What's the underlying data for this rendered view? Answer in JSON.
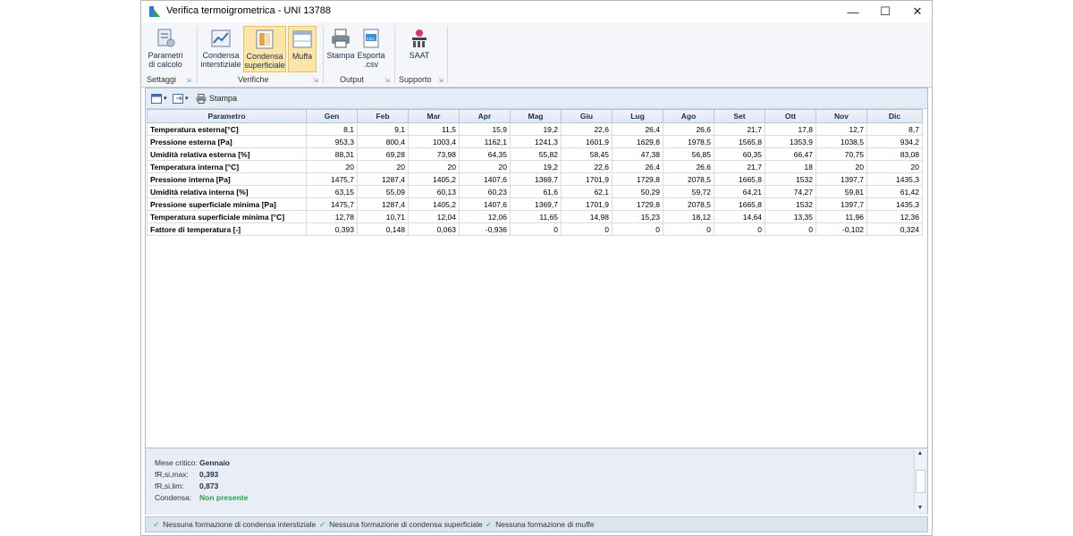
{
  "window": {
    "title": "Verifica termoigrometrica - UNI 13788",
    "controls": {
      "minimize": "—",
      "maximize": "☐",
      "close": "✕"
    }
  },
  "ribbon": {
    "groups": [
      {
        "label": "Settaggi",
        "buttons": [
          {
            "label_line1": "Parametri",
            "label_line2": "di calcolo",
            "icon": "sliders-icon"
          }
        ]
      },
      {
        "label": "Verifiche",
        "buttons": [
          {
            "label_line1": "Condensa",
            "label_line2": "interstiziale",
            "icon": "chart-icon"
          },
          {
            "label_line1": "Condensa",
            "label_line2": "superficiale",
            "icon": "panel-icon",
            "selected": true
          },
          {
            "label_line1": "Muffa",
            "label_line2": "",
            "icon": "window-icon",
            "selected": true
          }
        ]
      },
      {
        "label": "Output",
        "buttons": [
          {
            "label_line1": "Stampa",
            "label_line2": "",
            "icon": "printer-icon"
          },
          {
            "label_line1": "Esporta",
            "label_line2": ".csv",
            "icon": "export-icon"
          }
        ]
      },
      {
        "label": "Supporto",
        "buttons": [
          {
            "label_line1": "SAAT",
            "label_line2": "",
            "icon": "saat-icon"
          }
        ]
      }
    ]
  },
  "toolbar": {
    "print_label": "Stampa"
  },
  "table": {
    "columns": [
      "Parametro",
      "Gen",
      "Feb",
      "Mar",
      "Apr",
      "Mag",
      "Giu",
      "Lug",
      "Ago",
      "Set",
      "Ott",
      "Nov",
      "Dic"
    ],
    "rows": [
      [
        "Temperatura esterna[°C]",
        "8,1",
        "9,1",
        "11,5",
        "15,9",
        "19,2",
        "22,6",
        "26,4",
        "26,6",
        "21,7",
        "17,8",
        "12,7",
        "8,7"
      ],
      [
        "Pressione esterna [Pa]",
        "953,3",
        "800,4",
        "1003,4",
        "1162,1",
        "1241,3",
        "1601,9",
        "1629,8",
        "1978,5",
        "1565,8",
        "1353,9",
        "1038,5",
        "934,2"
      ],
      [
        "Umidità relativa esterna [%]",
        "88,31",
        "69,28",
        "73,98",
        "64,35",
        "55,82",
        "58,45",
        "47,38",
        "56,85",
        "60,35",
        "66,47",
        "70,75",
        "83,08"
      ],
      [
        "Temperatura interna [°C]",
        "20",
        "20",
        "20",
        "20",
        "19,2",
        "22,6",
        "26,4",
        "26,6",
        "21,7",
        "18",
        "20",
        "20"
      ],
      [
        "Pressione interna [Pa]",
        "1475,7",
        "1287,4",
        "1405,2",
        "1407,6",
        "1369,7",
        "1701,9",
        "1729,8",
        "2078,5",
        "1665,8",
        "1532",
        "1397,7",
        "1435,3"
      ],
      [
        "Umidità relativa interna [%]",
        "63,15",
        "55,09",
        "60,13",
        "60,23",
        "61,6",
        "62,1",
        "50,29",
        "59,72",
        "64,21",
        "74,27",
        "59,81",
        "61,42"
      ],
      [
        "Pressione superficiale minima [Pa]",
        "1475,7",
        "1287,4",
        "1405,2",
        "1407,6",
        "1369,7",
        "1701,9",
        "1729,8",
        "2078,5",
        "1665,8",
        "1532",
        "1397,7",
        "1435,3"
      ],
      [
        "Temperatura superficiale minima [°C]",
        "12,78",
        "10,71",
        "12,04",
        "12,06",
        "11,65",
        "14,98",
        "15,23",
        "18,12",
        "14,64",
        "13,35",
        "11,96",
        "12,36"
      ],
      [
        "Fattore di temperatura [-]",
        "0,393",
        "0,148",
        "0,063",
        "-0,936",
        "0",
        "0",
        "0",
        "0",
        "0",
        "0",
        "-0,102",
        "0,324"
      ]
    ]
  },
  "summary": {
    "mese_label": "Mese critico:",
    "mese_value": "Gennaio",
    "fmax_label": "fR,si,max:",
    "fmax_value": "0,393",
    "flim_label": "fR,si,lim:",
    "flim_value": "0,873",
    "condensa_label": "Condensa:",
    "condensa_value": "Non presente",
    "condensa_color": "#24a34a"
  },
  "status": {
    "item1": "Nessuna formazione di condensa interstiziale",
    "item2": "Nessuna formazione di condensa superficiale",
    "item3": "Nessuna formazione di muffe"
  },
  "colors": {
    "selected_bg": "#fbe6a8",
    "header_text": "#1f2e49"
  }
}
